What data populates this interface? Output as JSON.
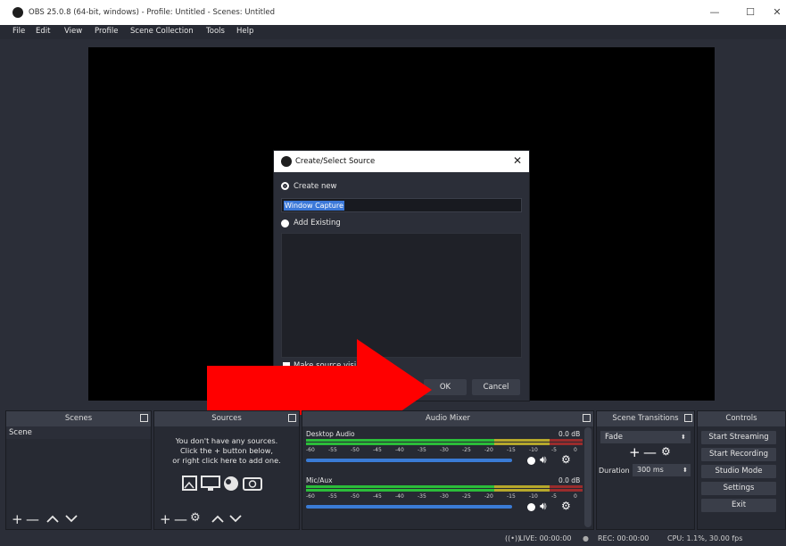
{
  "window": {
    "title": "OBS 25.0.8 (64-bit, windows) - Profile: Untitled - Scenes: Untitled",
    "minimize": "—",
    "maximize": "☐",
    "close": "✕"
  },
  "menu": [
    "File",
    "Edit",
    "View",
    "Profile",
    "Scene Collection",
    "Tools",
    "Help"
  ],
  "dialog": {
    "title": "Create/Select Source",
    "close": "✕",
    "create_new_label": "Create new",
    "name_value": "Window Capture",
    "add_existing_label": "Add Existing",
    "visible_label_partial": "Make source visible",
    "ok_label": "OK",
    "cancel_label": "Cancel"
  },
  "scenes": {
    "title": "Scenes",
    "items": [
      "Scene"
    ],
    "toolbar": [
      "+",
      "—",
      "^",
      "v"
    ]
  },
  "sources": {
    "title": "Sources",
    "empty_text": [
      "You don't have any sources.",
      "Click the + button below,",
      "or right click here to add one."
    ],
    "toolbar": [
      "+",
      "—",
      "⚙",
      "^",
      "v"
    ]
  },
  "audio_mixer": {
    "title": "Audio Mixer",
    "channels": [
      {
        "name": "Desktop Audio",
        "db": "0.0 dB",
        "volume": 0.93
      },
      {
        "name": "Mic/Aux",
        "db": "0.0 dB",
        "volume": 0.93
      }
    ],
    "ticks": [
      "-60",
      "-55",
      "-50",
      "-45",
      "-40",
      "-35",
      "-30",
      "-25",
      "-20",
      "-15",
      "-10",
      "-5",
      "0"
    ]
  },
  "transitions": {
    "title": "Scene Transitions",
    "selected": "Fade",
    "duration_label": "Duration",
    "duration_value": "300 ms"
  },
  "controls": {
    "title": "Controls",
    "buttons": [
      "Start Streaming",
      "Start Recording",
      "Studio Mode",
      "Settings",
      "Exit"
    ]
  },
  "status": {
    "live": "LIVE: 00:00:00",
    "rec": "REC: 00:00:00",
    "cpu": "CPU: 1.1%, 30.00 fps"
  },
  "colors": {
    "accent_red": "#ff0000",
    "meter_green": "#2bbd3a",
    "meter_yellow": "#b6a82b",
    "meter_red": "#9a2c2c",
    "slider_blue": "#3a7bd5"
  }
}
